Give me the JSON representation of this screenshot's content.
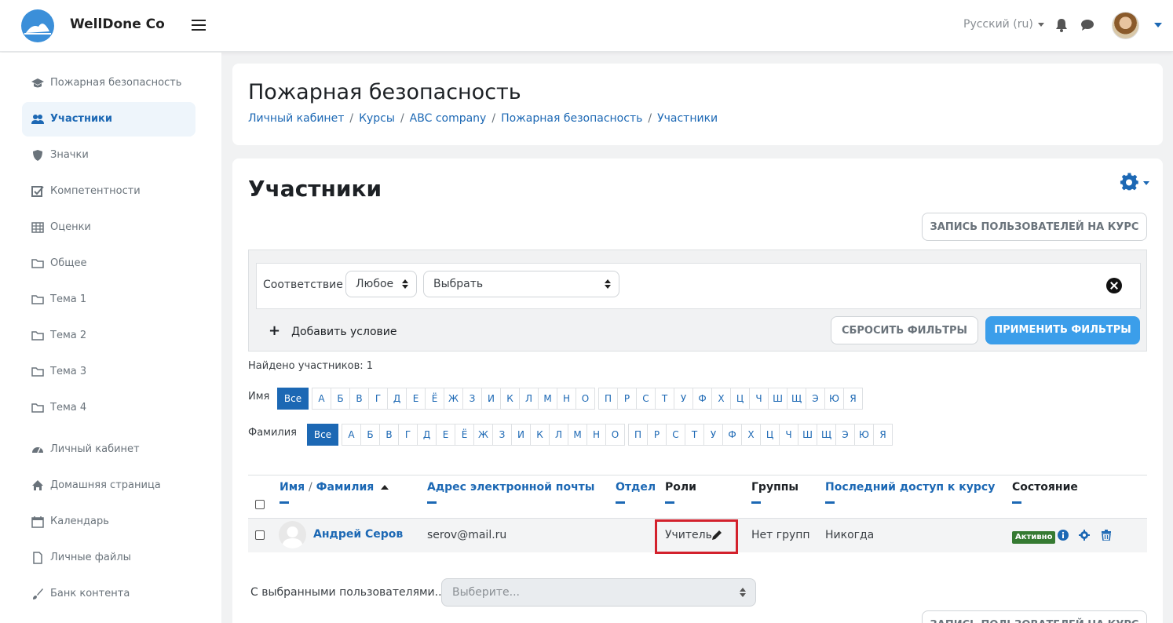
{
  "navbar": {
    "brand": "WellDone Co",
    "language": "Русский (ru)"
  },
  "sidebar": {
    "items": [
      {
        "label": "Пожарная безопасность",
        "icon": "graduation-cap-icon"
      },
      {
        "label": "Участники",
        "icon": "users-icon",
        "active": true
      },
      {
        "label": "Значки",
        "icon": "shield-icon"
      },
      {
        "label": "Компетентности",
        "icon": "checkbox-icon"
      },
      {
        "label": "Оценки",
        "icon": "table-icon"
      },
      {
        "label": "Общее",
        "icon": "folder-icon"
      },
      {
        "label": "Тема 1",
        "icon": "folder-icon"
      },
      {
        "label": "Тема 2",
        "icon": "folder-icon"
      },
      {
        "label": "Тема 3",
        "icon": "folder-icon"
      },
      {
        "label": "Тема 4",
        "icon": "folder-icon"
      },
      {
        "label": "Личный кабинет",
        "icon": "dashboard-icon"
      },
      {
        "label": "Домашняя страница",
        "icon": "home-icon"
      },
      {
        "label": "Календарь",
        "icon": "calendar-icon"
      },
      {
        "label": "Личные файлы",
        "icon": "file-icon"
      },
      {
        "label": "Банк контента",
        "icon": "brush-icon"
      }
    ]
  },
  "header": {
    "title": "Пожарная безопасность",
    "breadcrumb": [
      "Личный кабинет",
      "Курсы",
      "ABC company",
      "Пожарная безопасность",
      "Участники"
    ]
  },
  "main": {
    "title": "Участники",
    "enrol_button": "ЗАПИСЬ ПОЛЬЗОВАТЕЛЕЙ НА КУРС",
    "filter": {
      "match_label": "Соответствие",
      "match_value": "Любое",
      "type_value": "Выбрать",
      "add_condition": "Добавить условие",
      "reset": "СБРОСИТЬ ФИЛЬТРЫ",
      "apply": "ПРИМЕНИТЬ ФИЛЬТРЫ"
    },
    "found": "Найдено участников: 1",
    "first_name_label": "Имя",
    "last_name_label": "Фамилия",
    "all_label": "Все",
    "letters": [
      "А",
      "Б",
      "В",
      "Г",
      "Д",
      "Е",
      "Ё",
      "Ж",
      "З",
      "И",
      "К",
      "Л",
      "М",
      "Н",
      "О",
      "П",
      "Р",
      "С",
      "Т",
      "У",
      "Ф",
      "Х",
      "Ц",
      "Ч",
      "Ш",
      "Щ",
      "Э",
      "Ю",
      "Я"
    ],
    "table": {
      "col_name": "Имя",
      "col_name_sep": "/",
      "col_surname": "Фамилия",
      "col_email": "Адрес электронной почты",
      "col_dept": "Отдел",
      "col_roles": "Роли",
      "col_groups": "Группы",
      "col_last_access": "Последний доступ к курсу",
      "col_status": "Состояние",
      "rows": [
        {
          "name": "Андрей Серов",
          "email": "serov@mail.ru",
          "department": "",
          "role": "Учитель",
          "groups": "Нет групп",
          "last_access": "Никогда",
          "status": "Активно"
        }
      ]
    },
    "bulk_label": "С выбранными пользователями...",
    "bulk_placeholder": "Выберите..."
  },
  "colors": {
    "accent": "#1c68b4",
    "primary_button": "#3b9eea",
    "active_badge": "#357a32",
    "highlight_box": "#d3212c"
  }
}
